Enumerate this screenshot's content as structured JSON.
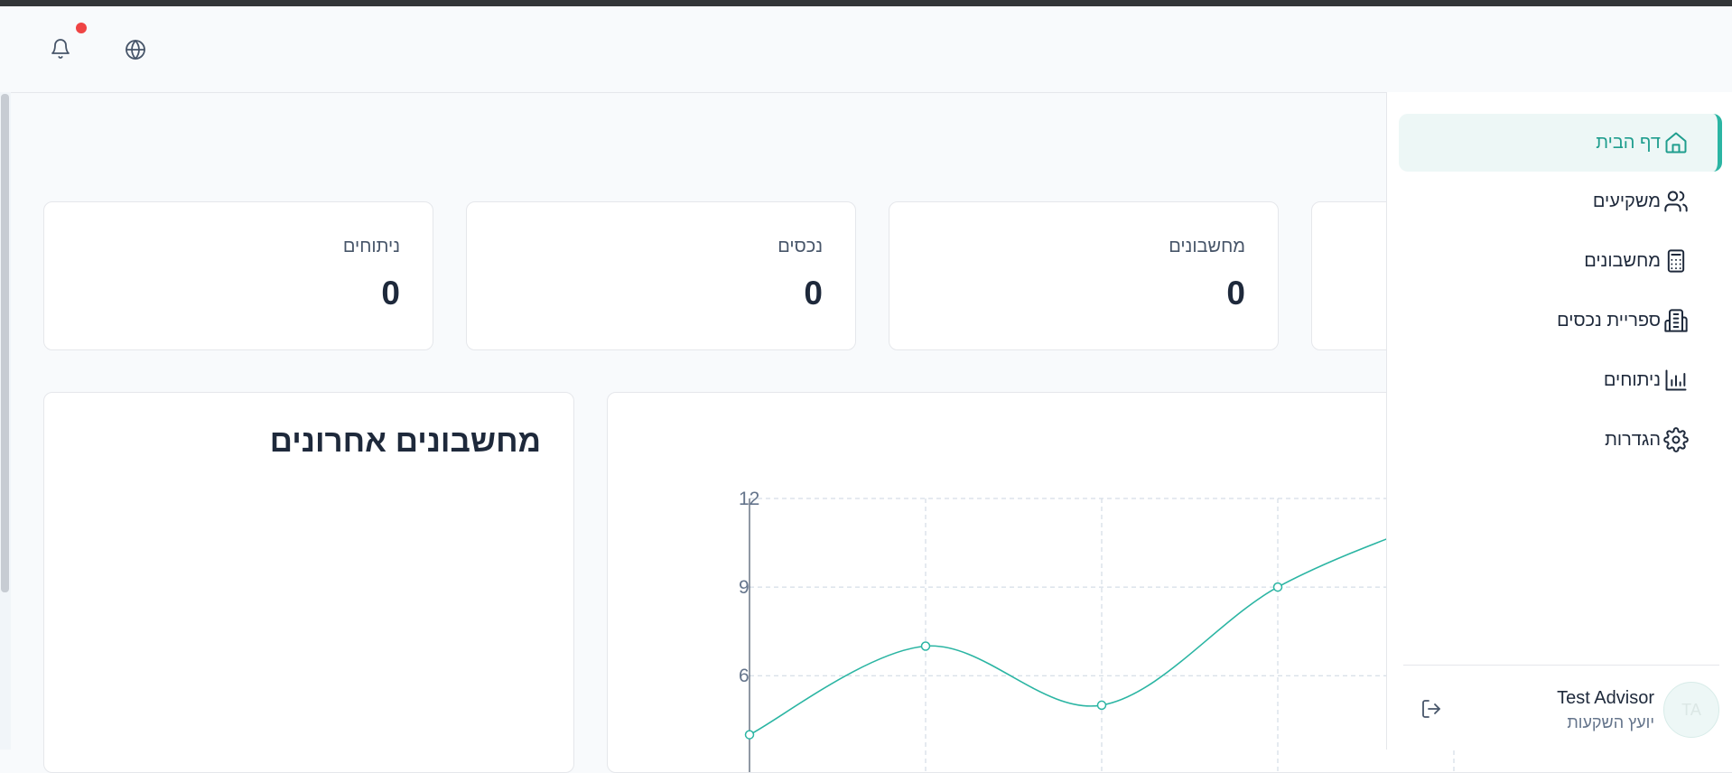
{
  "header": {
    "notifications_icon": "bell-icon",
    "language_icon": "globe-icon",
    "notification_dot_color": "#ef4444"
  },
  "stats": [
    {
      "label": "ניתוחים",
      "value": "0"
    },
    {
      "label": "נכסים",
      "value": "0"
    },
    {
      "label": "מחשבונים",
      "value": "0"
    }
  ],
  "recent": {
    "title": "מחשבונים אחרונים"
  },
  "sidebar": {
    "items": [
      {
        "label": "דף הבית",
        "icon": "home-icon",
        "active": true
      },
      {
        "label": "משקיעים",
        "icon": "users-icon",
        "active": false
      },
      {
        "label": "מחשבונים",
        "icon": "calculator-icon",
        "active": false
      },
      {
        "label": "ספריית נכסים",
        "icon": "building-icon",
        "active": false
      },
      {
        "label": "ניתוחים",
        "icon": "bar-chart-icon",
        "active": false
      },
      {
        "label": "הגדרות",
        "icon": "gear-icon",
        "active": false
      }
    ],
    "accent_color": "#2bb5a3"
  },
  "user": {
    "name": "Test Advisor",
    "role": "יועץ השקעות",
    "initials": "TA"
  },
  "chart_data": {
    "type": "line",
    "x": [
      0,
      1,
      2,
      3,
      4
    ],
    "values": [
      4,
      7,
      5,
      9,
      11.5
    ],
    "ylim": [
      0,
      12
    ],
    "yticks": [
      "12",
      "9",
      "6"
    ],
    "grid": true,
    "line_color": "#2bb5a3"
  }
}
